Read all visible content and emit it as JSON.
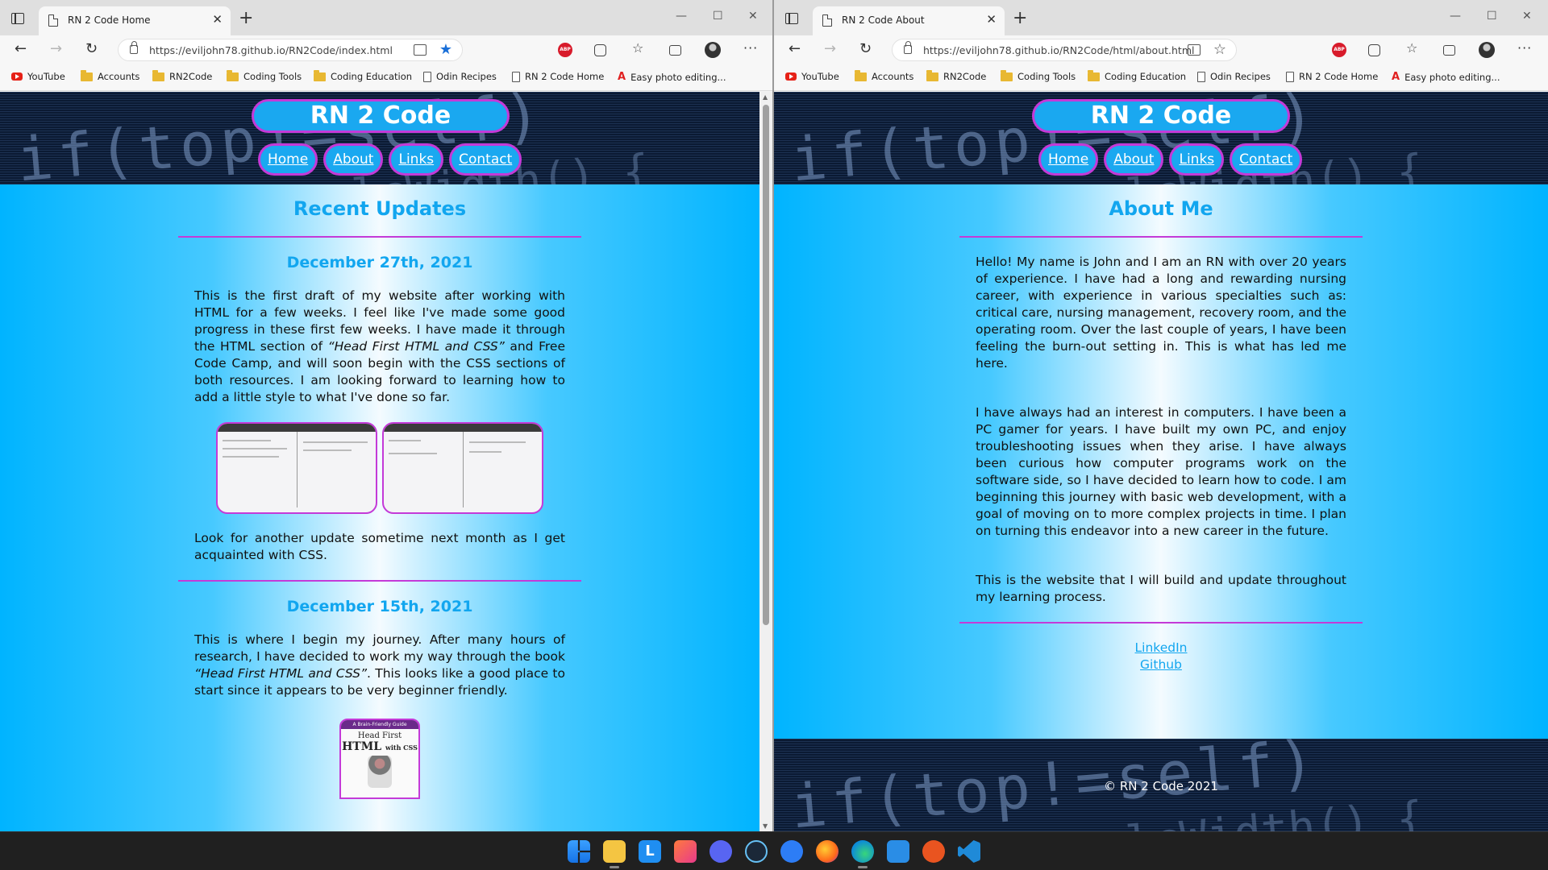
{
  "windows": {
    "left": {
      "tab_title": "RN 2 Code Home",
      "url": "https://eviljohn78.github.io/RN2Code/index.html",
      "favorited": true
    },
    "right": {
      "tab_title": "RN 2 Code About",
      "url": "https://eviljohn78.github.io/RN2Code/html/about.html",
      "favorited": false
    }
  },
  "bookmarks": [
    "YouTube",
    "Accounts",
    "RN2Code",
    "Coding Tools",
    "Coding Education",
    "Odin Recipes",
    "RN 2 Code Home",
    "Easy photo editing..."
  ],
  "site": {
    "title": "RN 2 Code",
    "nav": [
      "Home",
      "About",
      "Links",
      "Contact"
    ],
    "hero_code": "if(top!=self)",
    "hero_code2": "tion calcWidth() {"
  },
  "home": {
    "heading": "Recent Updates",
    "posts": [
      {
        "date": "December 27th, 2021",
        "text_pre": "This is the first draft of my website after working with HTML for a few weeks. I feel like I've made some good progress in these first few weeks. I have made it through the HTML section of ",
        "book_ref": "“Head First HTML and CSS”",
        "text_post": " and Free Code Camp, and will soon begin with the CSS sections of both resources. I am looking forward to learning how to add a little style to what I've done so far.",
        "followup": "Look for another update sometime next month as I get acquainted with CSS."
      },
      {
        "date": "December 15th, 2021",
        "text_pre": "This is where I begin my journey. After many hours of research, I have decided to work my way through the book ",
        "book_ref": "“Head First HTML and CSS”",
        "text_post": ". This looks like a good place to start since it appears to be very beginner friendly."
      }
    ],
    "book_cover": {
      "top": "A Brain-Friendly Guide",
      "line1": "Head First",
      "line2": "HTML",
      "line3": "with CSS"
    }
  },
  "about": {
    "heading": "About Me",
    "paragraphs": [
      "Hello! My name is John and I am an RN with over 20 years of experience. I have had a long and rewarding nursing career, with experience in various specialties such as: critical care, nursing management, recovery room, and the operating room. Over the last couple of years, I have been feeling the burn-out setting in. This is what has led me here.",
      "I have always had an interest in computers. I have been a PC gamer for years. I have built my own PC, and enjoy troubleshooting issues when they arise. I have always been curious how computer programs work on the software side, so I have decided to learn how to code. I am beginning this journey with basic web development, with a goal of moving on to more complex projects in time. I plan on turning this endeavor into a new career in the future.",
      "This is the website that I will build and update throughout my learning process."
    ],
    "links": [
      "LinkedIn",
      "Github"
    ],
    "footer": "© RN 2 Code 2021"
  },
  "colors": {
    "accent": "#12a6ef",
    "border": "#c43ad8",
    "pill": "#1aa8f0"
  },
  "taskbar_icons": [
    "windows-start-icon",
    "file-explorer-icon",
    "libre-icon",
    "paint-icon",
    "discord-icon",
    "steam-icon",
    "beta-app-icon",
    "firefox-icon",
    "edge-icon",
    "mail-icon",
    "ubuntu-icon",
    "vscode-icon"
  ]
}
